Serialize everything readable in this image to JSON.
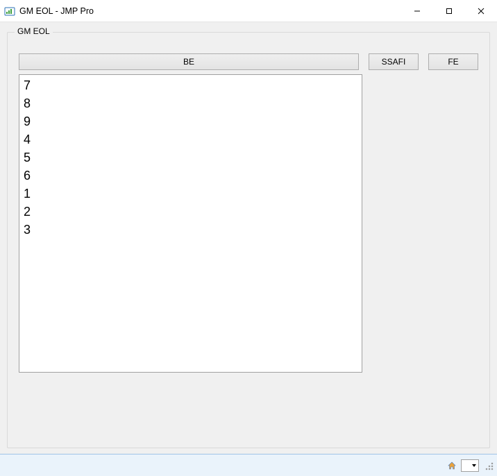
{
  "window": {
    "title": "GM EOL - JMP Pro",
    "icon": "jmp-app-icon"
  },
  "window_controls": {
    "minimize": "—",
    "maximize": "▢",
    "close": "✕"
  },
  "groupbox": {
    "legend": "GM EOL",
    "buttons": {
      "be": "BE",
      "ssafi": "SSAFI",
      "fe": "FE"
    },
    "list_items": [
      "7",
      "8",
      "9",
      "4",
      "5",
      "6",
      "1",
      "2",
      "3"
    ]
  },
  "statusbar": {
    "home_icon": "home-icon",
    "dropdown_symbol": "▾"
  }
}
